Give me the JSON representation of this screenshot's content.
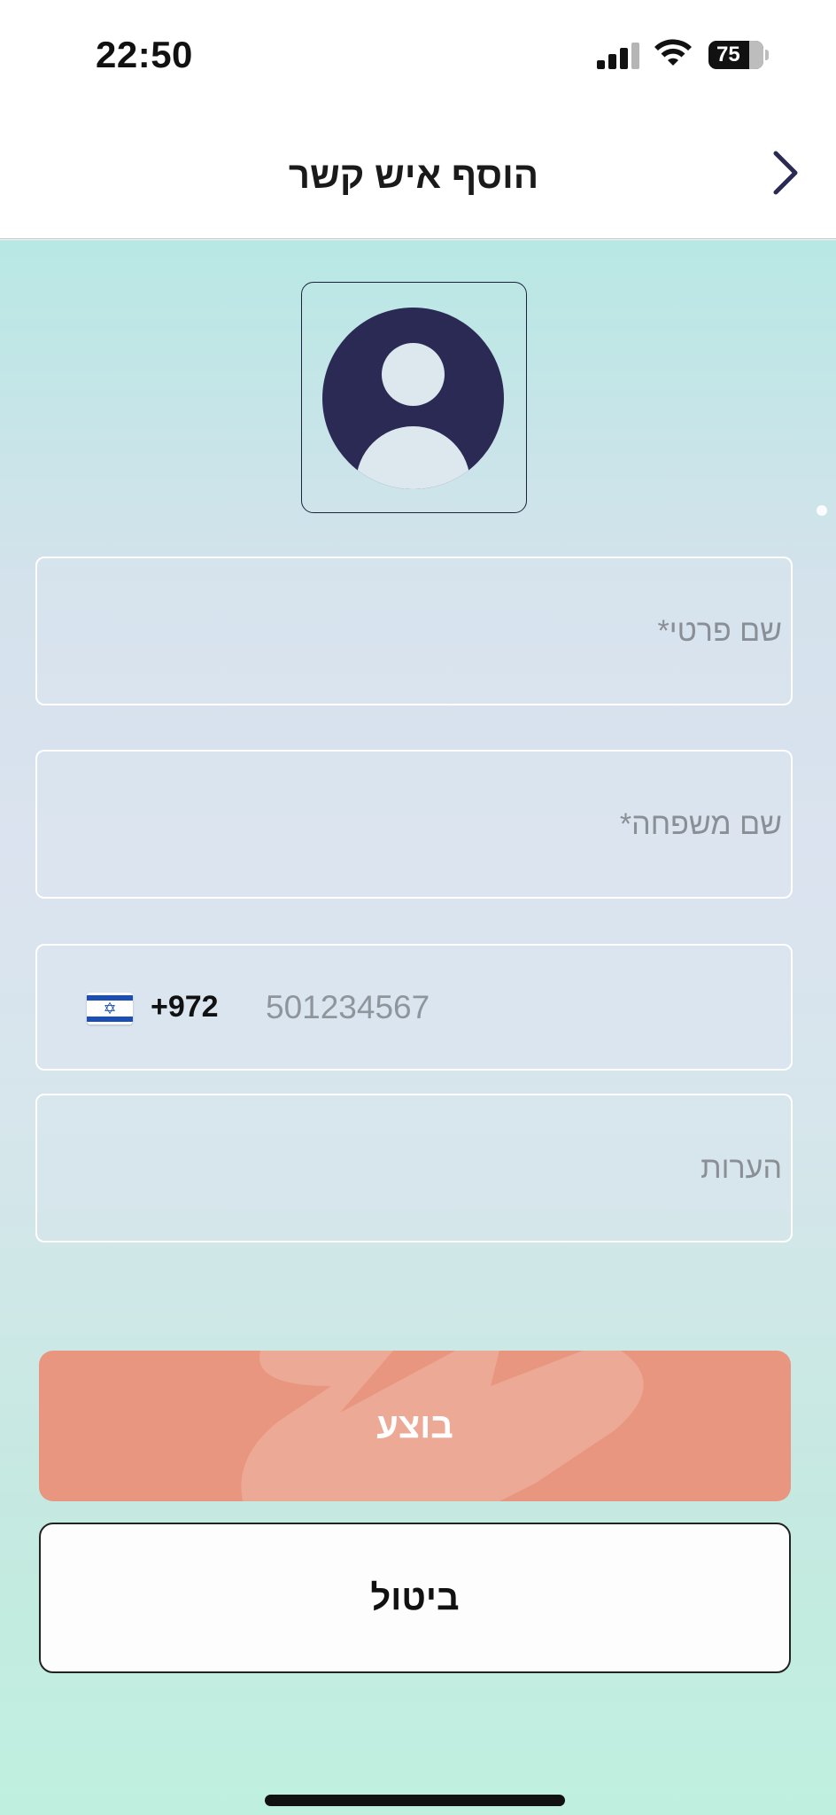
{
  "status_bar": {
    "time": "22:50",
    "battery_level": "75",
    "icons": [
      "signal-icon",
      "wifi-icon",
      "battery-icon"
    ]
  },
  "header": {
    "title": "הוסף איש קשר",
    "back_icon": "chevron-right-icon"
  },
  "avatar": {
    "icon": "user-avatar-icon"
  },
  "form": {
    "first_name_placeholder": "שם פרטי*",
    "last_name_placeholder": "שם משפחה*",
    "phone": {
      "country_flag": "israel-flag-icon",
      "dial_code": "+972",
      "placeholder": "501234567"
    },
    "notes_placeholder": "הערות"
  },
  "actions": {
    "submit_label": "בוצע",
    "cancel_label": "ביטול"
  },
  "colors": {
    "accent": "#e8967f",
    "avatar": "#2b2a55",
    "text_dark": "#1a1a1a",
    "placeholder": "#8a8f96"
  }
}
